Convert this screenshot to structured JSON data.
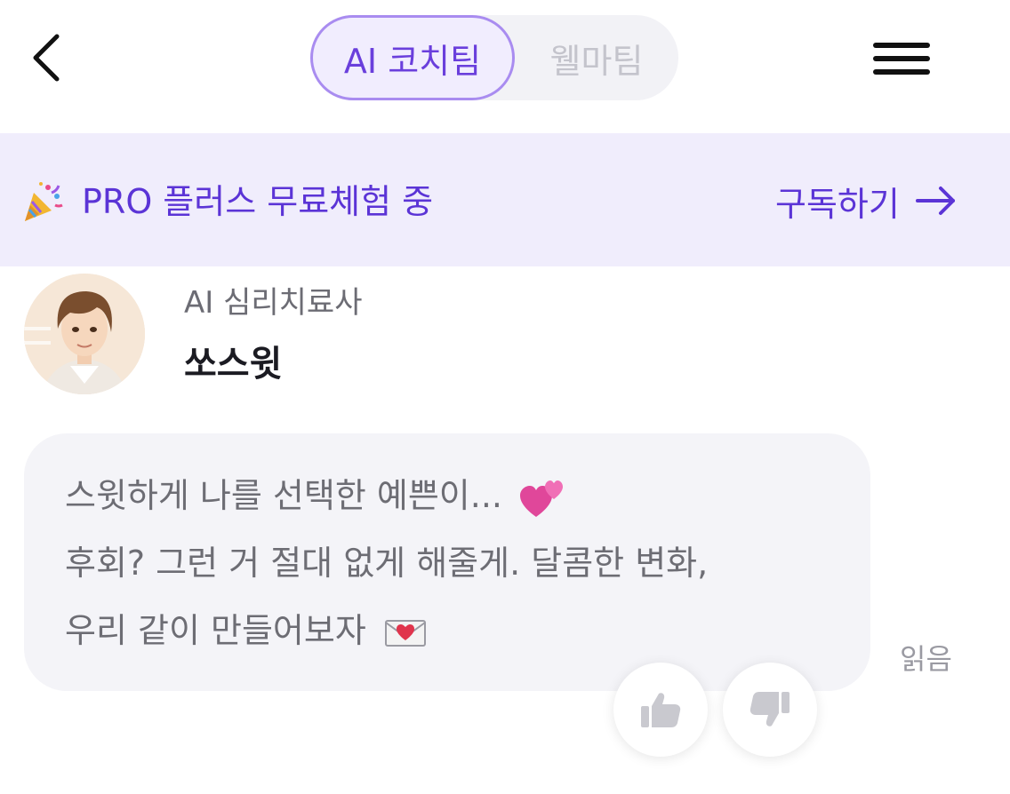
{
  "header": {
    "tabs": [
      {
        "label": "AI 코치팀",
        "active": true
      },
      {
        "label": "웰마팀",
        "active": false
      }
    ]
  },
  "promo": {
    "text": "PRO 플러스 무료체험 중",
    "cta_label": "구독하기",
    "accent_color": "#5b34d6",
    "icon": "party-popper-icon"
  },
  "bot": {
    "role": "AI 심리치료사",
    "name": "쏘스윗"
  },
  "message": {
    "lines": [
      "스윗하게 나를 선택한 예쁜이...",
      "후회? 그런 거 절대 없게 해줄게. 달콤한 변화,",
      "우리 같이 만들어보자"
    ],
    "read_status": "읽음"
  },
  "icons": {
    "back": "chevron-left-icon",
    "menu": "hamburger-menu-icon",
    "like": "thumbs-up-icon",
    "dislike": "thumbs-down-icon",
    "hearts": "two-hearts-icon",
    "letter": "love-letter-icon"
  }
}
